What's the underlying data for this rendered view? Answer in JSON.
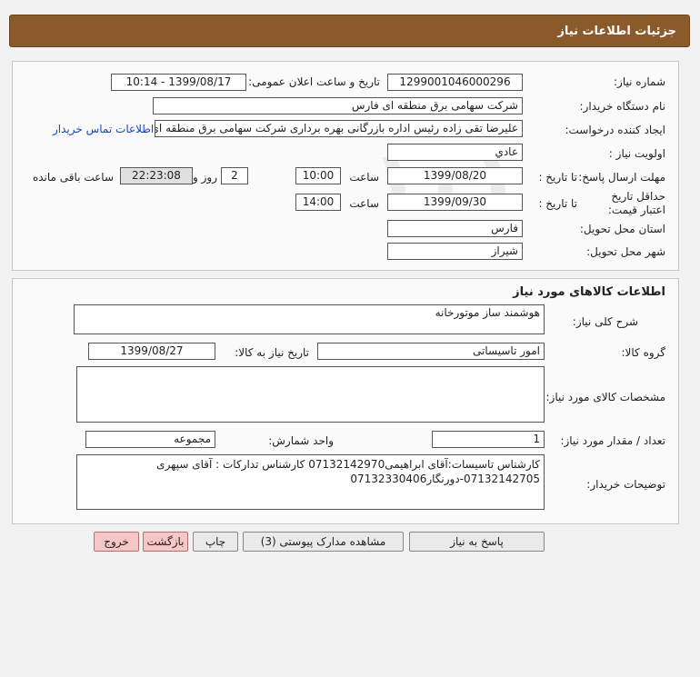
{
  "page_title": "جزئیات اطلاعات نیاز",
  "need_info": {
    "need_number_label": "شماره نیاز:",
    "need_number": "1299001046000296",
    "announce_label": "تاریخ و ساعت اعلان عمومی:",
    "announce_value": "1399/08/17 - 10:14",
    "buyer_org_label": "نام دستگاه خریدار:",
    "buyer_org": "شرکت سهامی برق منطقه ای فارس",
    "requester_label": "ایجاد کننده درخواست:",
    "requester": "علیرضا  تقی زاده رئیس اداره بازرگانی بهره برداری شرکت سهامی برق منطقه ای",
    "contact_link": "اطلاعات تماس خریدار",
    "priority_label": "اولویت نیاز :",
    "priority": "عادي",
    "reply_deadline_label": "مهلت ارسال پاسخ:",
    "to_date_label": "تا تاریخ :",
    "reply_date": "1399/08/20",
    "time_label": "ساعت",
    "reply_time": "10:00",
    "days_value": "2",
    "days_label": "روز و",
    "remaining_time": "22:23:08",
    "remaining_label": "ساعت باقی مانده",
    "price_validity_label": "حداقل تاریخ اعتبار قیمت:",
    "price_to_date_label": "تا تاریخ :",
    "price_date": "1399/09/30",
    "price_time_label": "ساعت",
    "price_time": "14:00",
    "province_label": "استان محل تحویل:",
    "province": "فارس",
    "city_label": "شهر محل تحویل:",
    "city": "شیراز"
  },
  "goods": {
    "section_title": "اطلاعات کالاهای مورد نیاز",
    "summary_label": "شرح کلی نیاز:",
    "summary": "هوشمند ساز موتورخانه",
    "group_label": "گروه کالا:",
    "group": "امور تاسیساتی",
    "need_date_label": "تاریخ نیاز به کالا:",
    "need_date": "1399/08/27",
    "specs_label": "مشخصات کالای مورد نیاز:",
    "specs": "",
    "qty_label": "تعداد / مقدار مورد نیاز:",
    "qty": "1",
    "unit_label": "واحد شمارش:",
    "unit": "مجموعه",
    "buyer_notes_label": "توضیحات خریدار:",
    "buyer_notes": "کارشناس تاسیسات:آقای ابراهیمی07132142970 کارشناس تدارکات : آقای سپهری 07132142705-دورنگار07132330406"
  },
  "watermark": {
    "main": "ParsNamadData",
    "line1": "مرکز فرآوری اطلاعات پارس نماد داده ها",
    "line2": "پایگاه اطلاع رسانی مناقصه و مزایده",
    "phone": "۰۲۱-۸۸۳۴۹۶۷۰"
  },
  "buttons": {
    "reply": "پاسخ به نیاز",
    "attachments": "مشاهده مدارک پیوستی (3)",
    "print": "چاپ",
    "back": "بازگشت",
    "exit": "خروج"
  }
}
